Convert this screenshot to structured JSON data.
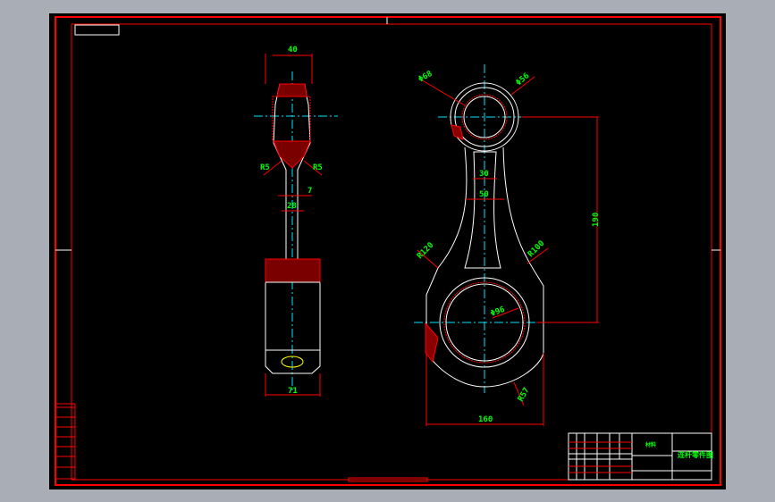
{
  "colors": {
    "background": "#000000",
    "frame": "#ff0000",
    "outline": "#ffffff",
    "centerline": "#00e5ff",
    "dimension_text": "#00ff00"
  },
  "side_view": {
    "dims": {
      "top_width": "40",
      "fillet_left": "R5",
      "fillet_right": "R5",
      "web": "7",
      "shank": "28",
      "bottom_width": "71"
    }
  },
  "front_view": {
    "dims": {
      "small_end_outer": "Φ68",
      "small_end_inner": "Φ56",
      "web_inner": "30",
      "web_outer": "50",
      "center_distance": "190",
      "fillet_left": "R120",
      "fillet_right": "R100",
      "big_end_bore": "Φ96",
      "big_end_radius": "R57",
      "big_end_width": "160"
    }
  },
  "title_block": {
    "drawing_name": "连杆零件图",
    "material": "材料"
  }
}
